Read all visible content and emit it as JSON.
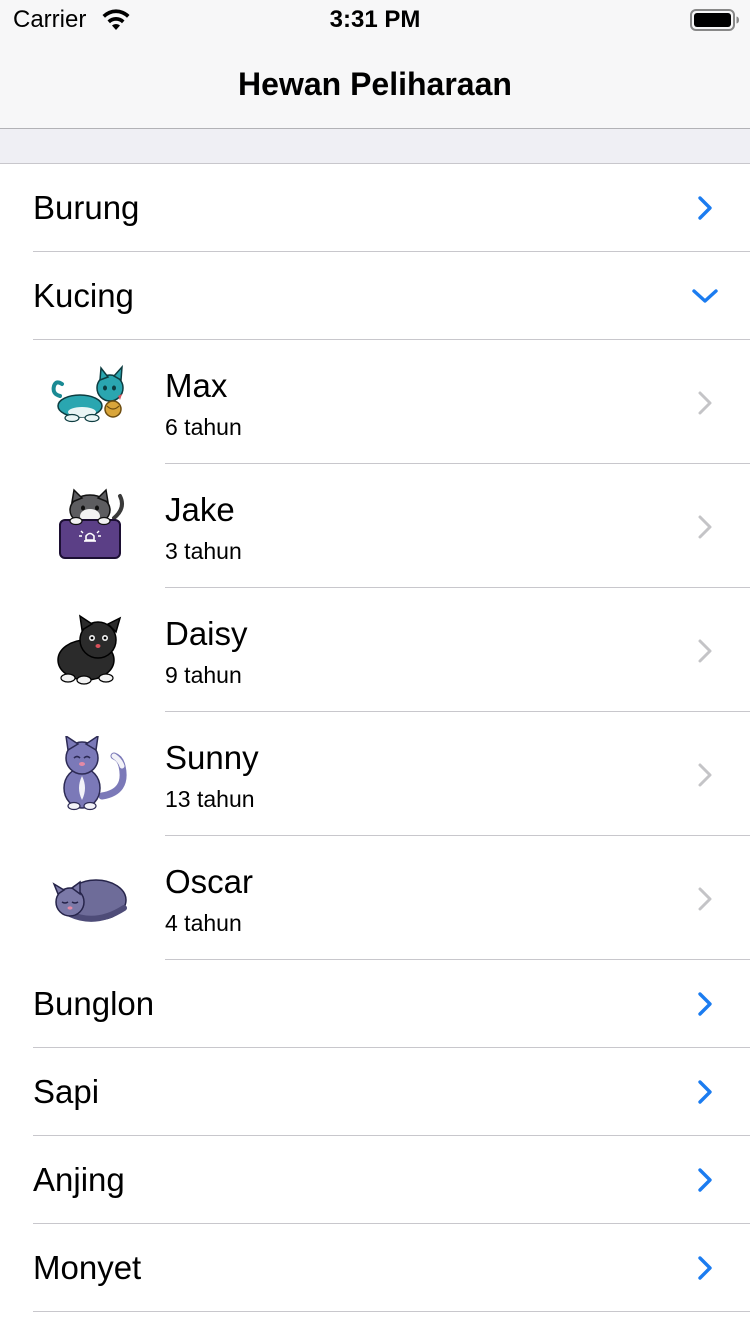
{
  "status_bar": {
    "carrier": "Carrier",
    "time": "3:31 PM",
    "wifi_icon": "wifi-icon",
    "battery_icon": "battery-icon"
  },
  "nav": {
    "title": "Hewan Peliharaan"
  },
  "colors": {
    "accent": "#1b7cf0",
    "chevron_gray": "#c4c4c7",
    "separator": "#c8c7cc",
    "bar_background": "#f7f7f8",
    "section_gap": "#efeff4"
  },
  "categories": [
    {
      "label": "Burung",
      "expanded": false
    },
    {
      "label": "Kucing",
      "expanded": true
    },
    {
      "label": "Bunglon",
      "expanded": false
    },
    {
      "label": "Sapi",
      "expanded": false
    },
    {
      "label": "Anjing",
      "expanded": false
    },
    {
      "label": "Monyet",
      "expanded": false
    }
  ],
  "kucing_items": [
    {
      "name": "Max",
      "age": "6 tahun",
      "image": "teal-cat-with-ball"
    },
    {
      "name": "Jake",
      "age": "3 tahun",
      "image": "gray-cat-with-purple-box"
    },
    {
      "name": "Daisy",
      "age": "9 tahun",
      "image": "black-cat-sitting"
    },
    {
      "name": "Sunny",
      "age": "13 tahun",
      "image": "lavender-cat-sitting"
    },
    {
      "name": "Oscar",
      "age": "4 tahun",
      "image": "sleeping-gray-cat"
    }
  ]
}
